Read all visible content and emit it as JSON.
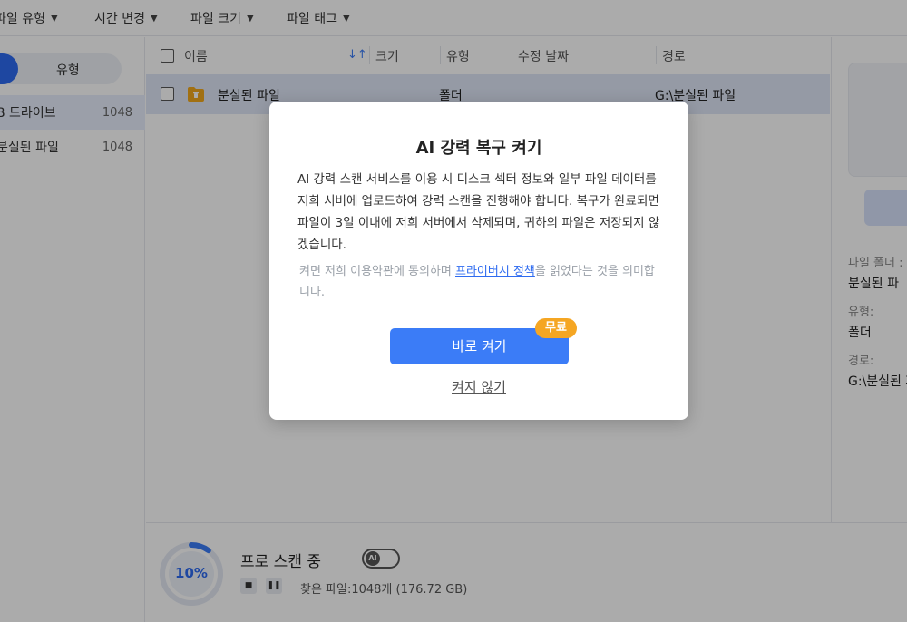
{
  "filters": [
    {
      "label": "파일 유형"
    },
    {
      "label": "시간 변경"
    },
    {
      "label": "파일 크기"
    },
    {
      "label": "파일 태그"
    }
  ],
  "sidebar": {
    "segment_label": "유형",
    "items": [
      {
        "label": "B 드라이브",
        "count": "1048"
      },
      {
        "label": "분실된 파일",
        "count": "1048"
      }
    ]
  },
  "table": {
    "columns": {
      "name": "이름",
      "sort": "↓↑",
      "size": "크기",
      "type": "유형",
      "modified": "수정 날짜",
      "path": "경로"
    },
    "rows": [
      {
        "name": "분실된 파일",
        "size": "",
        "type": "폴더",
        "modified": "",
        "path": "G:\\분실된 파일"
      }
    ]
  },
  "details": {
    "folder_label": "파일 폴더 :",
    "folder_value": "분실된 파",
    "type_label": "유형:",
    "type_value": "폴더",
    "path_label": "경로:",
    "path_value": "G:\\분실된 파"
  },
  "scan": {
    "progress_text": "10%",
    "progress": 0.1,
    "title": "프로 스캔 중",
    "ai_label": "AI",
    "found_text": "찾은 파일:1048개 (176.72 GB)"
  },
  "modal": {
    "title": "AI 강력 복구 켜기",
    "body": "AI 강력 스캔 서비스를 이용 시 디스크 섹터 정보와 일부 파일 데이터를 저희 서버에 업로드하여 강력 스캔을 진행해야 합니다. 복구가 완료되면 파일이 3일 이내에 저희 서버에서 삭제되며, 귀하의 파일은 저장되지 않겠습니다.",
    "note_prefix": "켜면 저희 이용약관에 동의하며 ",
    "note_link": "프라이버시 정책",
    "note_suffix": "을 읽었다는 것을 의미합니다.",
    "primary_button": "바로 켜기",
    "badge": "무료",
    "secondary_button": "켜지 않기"
  },
  "colors": {
    "accent": "#3b7cf7",
    "badge": "#f5a623",
    "selected_row": "#dfe6f7"
  }
}
